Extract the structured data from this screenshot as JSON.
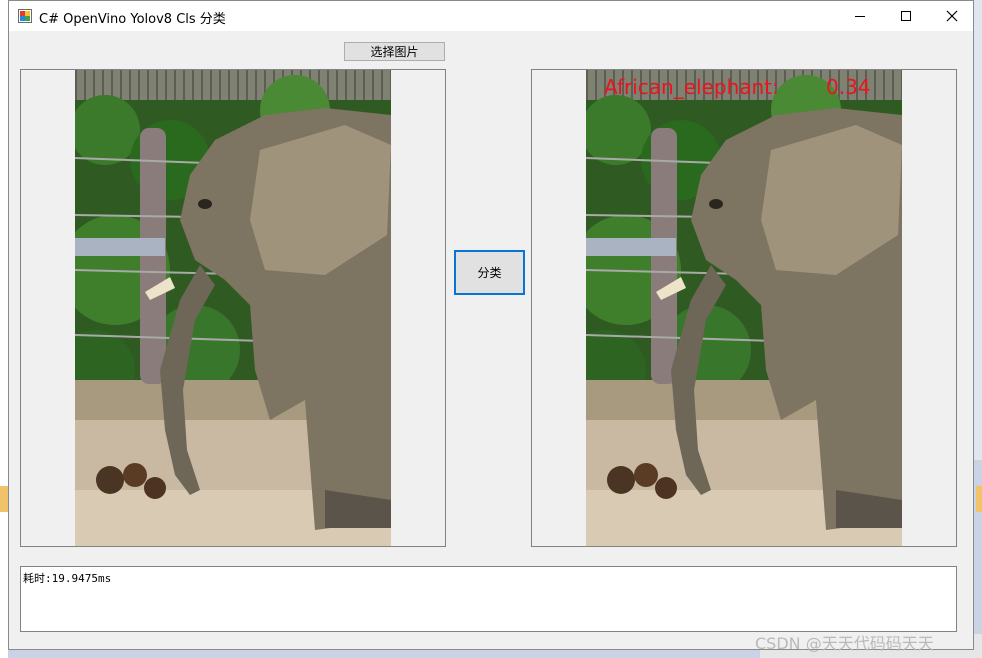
{
  "window": {
    "title": "C# OpenVino Yolov8 Cls 分类",
    "controls": {
      "minimize": "minimize-icon",
      "maximize": "maximize-icon",
      "close": "close-icon"
    }
  },
  "toolbar": {
    "select_image_label": "选择图片"
  },
  "classify": {
    "button_label": "分类"
  },
  "result": {
    "label": "African_elephant:",
    "score": "0.34",
    "color": "#e8141e"
  },
  "output": {
    "text": "耗时:19.9475ms"
  },
  "watermark": {
    "text": "CSDN @天天代码码天天"
  }
}
